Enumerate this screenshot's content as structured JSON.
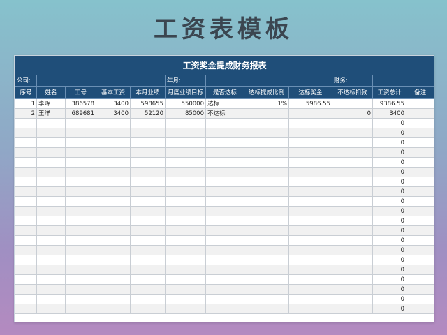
{
  "page_title": "工资表模板",
  "sheet": {
    "title": "工资奖金提成财务报表",
    "info": {
      "company_label": "公司:",
      "period_label": "年月:",
      "finance_label": "财务:"
    },
    "columns": [
      "序号",
      "姓名",
      "工号",
      "基本工资",
      "本月业绩",
      "月度业绩目标",
      "是否达标",
      "达标提成比例",
      "达标奖金",
      "不达标扣款",
      "工资总计",
      "备注"
    ],
    "rows": [
      [
        "1",
        "李晖",
        "386578",
        "3400",
        "598655",
        "550000",
        "达标",
        "1%",
        "5986.55",
        "",
        "9386.55",
        ""
      ],
      [
        "2",
        "王洋",
        "689681",
        "3400",
        "52120",
        "85000",
        "不达标",
        "",
        "",
        "0",
        "3400",
        ""
      ],
      [
        "",
        "",
        "",
        "",
        "",
        "",
        "",
        "",
        "",
        "",
        "0",
        ""
      ],
      [
        "",
        "",
        "",
        "",
        "",
        "",
        "",
        "",
        "",
        "",
        "0",
        ""
      ],
      [
        "",
        "",
        "",
        "",
        "",
        "",
        "",
        "",
        "",
        "",
        "0",
        ""
      ],
      [
        "",
        "",
        "",
        "",
        "",
        "",
        "",
        "",
        "",
        "",
        "0",
        ""
      ],
      [
        "",
        "",
        "",
        "",
        "",
        "",
        "",
        "",
        "",
        "",
        "0",
        ""
      ],
      [
        "",
        "",
        "",
        "",
        "",
        "",
        "",
        "",
        "",
        "",
        "0",
        ""
      ],
      [
        "",
        "",
        "",
        "",
        "",
        "",
        "",
        "",
        "",
        "",
        "0",
        ""
      ],
      [
        "",
        "",
        "",
        "",
        "",
        "",
        "",
        "",
        "",
        "",
        "0",
        ""
      ],
      [
        "",
        "",
        "",
        "",
        "",
        "",
        "",
        "",
        "",
        "",
        "0",
        ""
      ],
      [
        "",
        "",
        "",
        "",
        "",
        "",
        "",
        "",
        "",
        "",
        "0",
        ""
      ],
      [
        "",
        "",
        "",
        "",
        "",
        "",
        "",
        "",
        "",
        "",
        "0",
        ""
      ],
      [
        "",
        "",
        "",
        "",
        "",
        "",
        "",
        "",
        "",
        "",
        "0",
        ""
      ],
      [
        "",
        "",
        "",
        "",
        "",
        "",
        "",
        "",
        "",
        "",
        "0",
        ""
      ],
      [
        "",
        "",
        "",
        "",
        "",
        "",
        "",
        "",
        "",
        "",
        "0",
        ""
      ],
      [
        "",
        "",
        "",
        "",
        "",
        "",
        "",
        "",
        "",
        "",
        "0",
        ""
      ],
      [
        "",
        "",
        "",
        "",
        "",
        "",
        "",
        "",
        "",
        "",
        "0",
        ""
      ],
      [
        "",
        "",
        "",
        "",
        "",
        "",
        "",
        "",
        "",
        "",
        "0",
        ""
      ],
      [
        "",
        "",
        "",
        "",
        "",
        "",
        "",
        "",
        "",
        "",
        "0",
        ""
      ],
      [
        "",
        "",
        "",
        "",
        "",
        "",
        "",
        "",
        "",
        "",
        "0",
        ""
      ],
      [
        "",
        "",
        "",
        "",
        "",
        "",
        "",
        "",
        "",
        "",
        "0",
        ""
      ]
    ]
  },
  "colors": {
    "header_bg": "#1f4e79",
    "header_text": "#ffffff",
    "alt_row_bg": "#f1f1f1"
  }
}
